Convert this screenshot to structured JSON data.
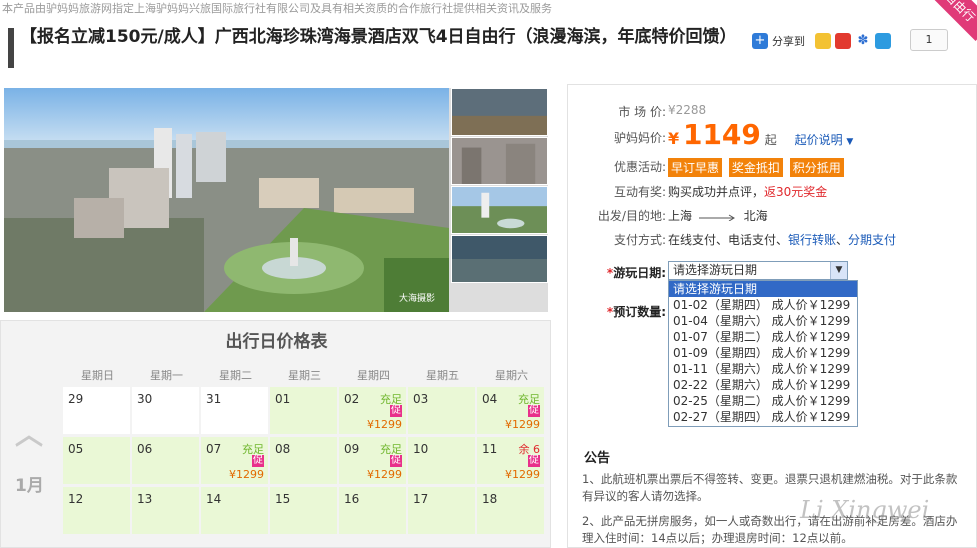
{
  "top_notice": "本产品由驴妈妈旅游网指定上海驴妈妈兴旅国际旅行社有限公司及具有相关资质的合作旅行社提供相关资讯及服务",
  "corner_badge": "自由行",
  "title": "【报名立减150元/成人】广西北海珍珠湾海景酒店双飞4日自由行（浪漫海滨，年底特价回馈）",
  "share": {
    "label": "分享到",
    "count": "1"
  },
  "photo": {
    "watermark": "大海摄影"
  },
  "calendar": {
    "title": "出行日价格表",
    "weekdays": [
      "星期日",
      "星期一",
      "星期二",
      "星期三",
      "星期四",
      "星期五",
      "星期六"
    ],
    "month": "1月",
    "rows": [
      [
        {
          "d": "29",
          "avail": false
        },
        {
          "d": "30",
          "avail": false
        },
        {
          "d": "31",
          "avail": false
        },
        {
          "d": "01",
          "avail": true
        },
        {
          "d": "02",
          "avail": true,
          "status": "充足",
          "promo": "促",
          "price": "¥1299"
        },
        {
          "d": "03",
          "avail": true
        },
        {
          "d": "04",
          "avail": true,
          "status": "充足",
          "promo": "促",
          "price": "¥1299"
        }
      ],
      [
        {
          "d": "05",
          "avail": true
        },
        {
          "d": "06",
          "avail": true
        },
        {
          "d": "07",
          "avail": true,
          "status": "充足",
          "promo": "促",
          "price": "¥1299"
        },
        {
          "d": "08",
          "avail": true
        },
        {
          "d": "09",
          "avail": true,
          "status": "充足",
          "promo": "促",
          "price": "¥1299"
        },
        {
          "d": "10",
          "avail": true
        },
        {
          "d": "11",
          "avail": true,
          "status": "余 6",
          "low": true,
          "promo": "促",
          "price": "¥1299"
        }
      ],
      [
        {
          "d": "12",
          "avail": true
        },
        {
          "d": "13",
          "avail": true
        },
        {
          "d": "14",
          "avail": true
        },
        {
          "d": "15",
          "avail": true
        },
        {
          "d": "16",
          "avail": true
        },
        {
          "d": "17",
          "avail": true
        },
        {
          "d": "18",
          "avail": true
        }
      ]
    ]
  },
  "panel": {
    "market_label": "市 场 价:",
    "market_price": "¥2288",
    "lv_label": "驴妈妈价:",
    "currency": "¥",
    "price": "1149",
    "price_suffix": "起",
    "price_explain": "起价说明",
    "promo_label": "优惠活动:",
    "promo_badges": [
      "早订早惠",
      "奖金抵扣",
      "积分抵用"
    ],
    "reward_label": "互动有奖:",
    "reward_text": "购买成功并点评，",
    "reward_red": "返30元奖金",
    "route_label": "出发/目的地:",
    "route_from": "上海",
    "route_to": "北海",
    "pay_label": "支付方式:",
    "pay_text": "在线支付、电话支付、",
    "pay_link1": "银行转账",
    "pay_sep": "、",
    "pay_link2": "分期支付",
    "date_label": "游玩日期:",
    "qty_label": "预订数量:",
    "select_value": "请选择游玩日期",
    "options": [
      "请选择游玩日期",
      "01-02（星期四） 成人价￥1299",
      "01-04（星期六） 成人价￥1299",
      "01-07（星期二） 成人价￥1299",
      "01-09（星期四） 成人价￥1299",
      "01-11（星期六） 成人价￥1299",
      "02-22（星期六） 成人价￥1299",
      "02-25（星期二） 成人价￥1299",
      "02-27（星期四） 成人价￥1299"
    ],
    "notice_title": "公告",
    "notice_1": "1、此航班机票出票后不得签转、变更。退票只退机建燃油税。对于此条款有异议的客人请勿选择。",
    "notice_2": "2、此产品无拼房服务，如一人或奇数出行，请在出游前补足房差。酒店办理入住时间：14点以后；办理退房时间：12点以前。"
  },
  "signature": "Li Xingwei"
}
